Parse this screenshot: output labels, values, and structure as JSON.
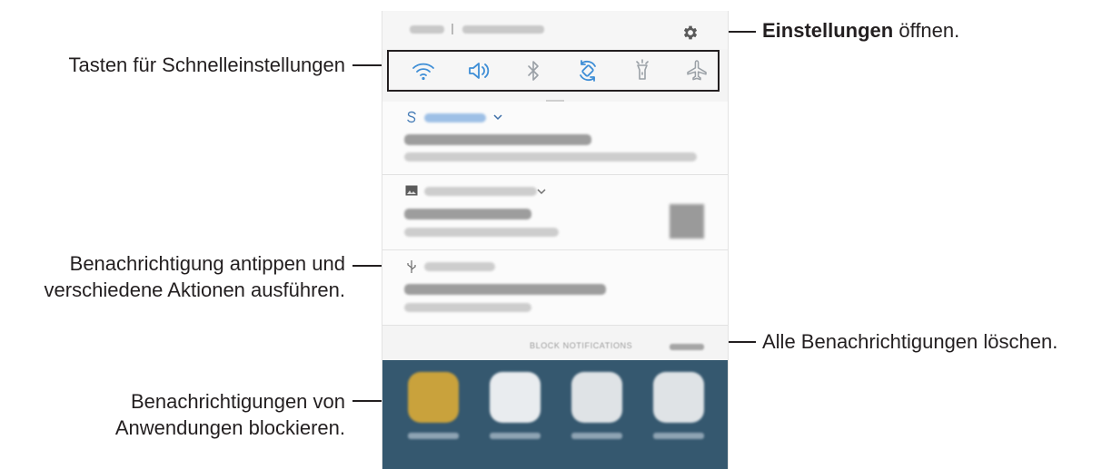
{
  "callouts": {
    "quick_settings": "Tasten für Schnelleinstellungen",
    "settings_bold": "Einstellungen",
    "settings_rest": " öffnen.",
    "tap_notification_line1": "Benachrichtigung antippen und",
    "tap_notification_line2": "verschiedene Aktionen ausführen.",
    "clear_all": "Alle Benachrichtigungen löschen.",
    "block_line1": "Benachrichtigungen von",
    "block_line2": "Anwendungen blockieren."
  },
  "panel": {
    "quick_settings": [
      {
        "icon": "wifi-icon",
        "active": true
      },
      {
        "icon": "sound-icon",
        "active": true
      },
      {
        "icon": "bluetooth-icon",
        "active": false
      },
      {
        "icon": "auto-rotate-icon",
        "active": true
      },
      {
        "icon": "flashlight-icon",
        "active": false
      },
      {
        "icon": "airplane-mode-icon",
        "active": false
      }
    ],
    "notifications": [
      {
        "icon": "smart-switch-icon"
      },
      {
        "icon": "screenshot-icon"
      },
      {
        "icon": "usb-icon"
      }
    ],
    "block_notifications": "BLOCK NOTIFICATIONS"
  },
  "colors": {
    "accent_blue": "#3e8ed6",
    "inactive_icon": "#9aa0a6",
    "home_background": "#35586f"
  }
}
